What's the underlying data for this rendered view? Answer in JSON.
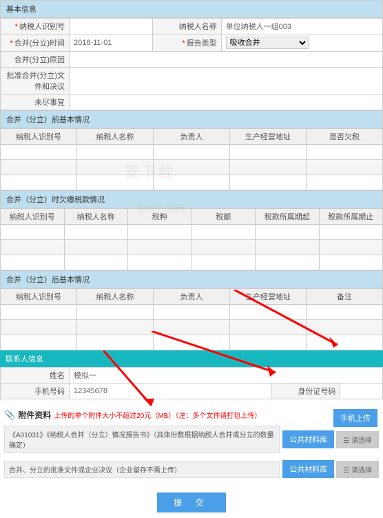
{
  "sections": {
    "basic": "基本信息",
    "before": "合并（分立）前基本情况",
    "arrears": "合并（分立）时欠缴税款情况",
    "after": "合并（分立）后基本情况",
    "contact": "联系人信息"
  },
  "basic": {
    "taxpayer_id_label": "纳税人识别号",
    "taxpayer_id": "",
    "merge_date_label": "合并(分立)时间",
    "merge_date": "2018-11-01",
    "taxpayer_name_label": "纳税人名称",
    "taxpayer_name": "单位纳税人一组003",
    "report_type_label": "报告类型",
    "report_type": "吸收合并",
    "merge_reason_label": "合并(分立)原因",
    "approval_doc_label": "批准合并(分立)文件和决议",
    "pending_label": "未尽事宜"
  },
  "before_cols": [
    "纳税人识别号",
    "纳税人名称",
    "负责人",
    "生产经营地址",
    "是否欠税"
  ],
  "arrears_cols": [
    "纳税人识别号",
    "纳税人名称",
    "税种",
    "税额",
    "税款所属期起",
    "税款所属期止"
  ],
  "after_cols": [
    "纳税人识别号",
    "纳税人名称",
    "负责人",
    "生产经营地址",
    "备注"
  ],
  "contact": {
    "name_label": "姓名",
    "name": "模拟一",
    "phone_label": "手机号码",
    "phone": "12345678",
    "id_label": "身份证号码",
    "id": ""
  },
  "attach": {
    "title": "附件资料",
    "note": "上传的单个附件大小不超过20元（MB）（注：多个文件请打包上传）",
    "row1": "《A01031》《纳税人合并（分立）情况报告书》（具体份数根据纳税人合并或分立的数量确定）",
    "row2": "合并、分立的批准文件或企业决议（企业留存不需上传）",
    "btn_upload": "手机上传",
    "btn_lib": "公共材料库",
    "btn_select": "☰ 请选择"
  },
  "submit": "提 交",
  "watermark1": "安下载",
  "watermark2": "anxz.com"
}
